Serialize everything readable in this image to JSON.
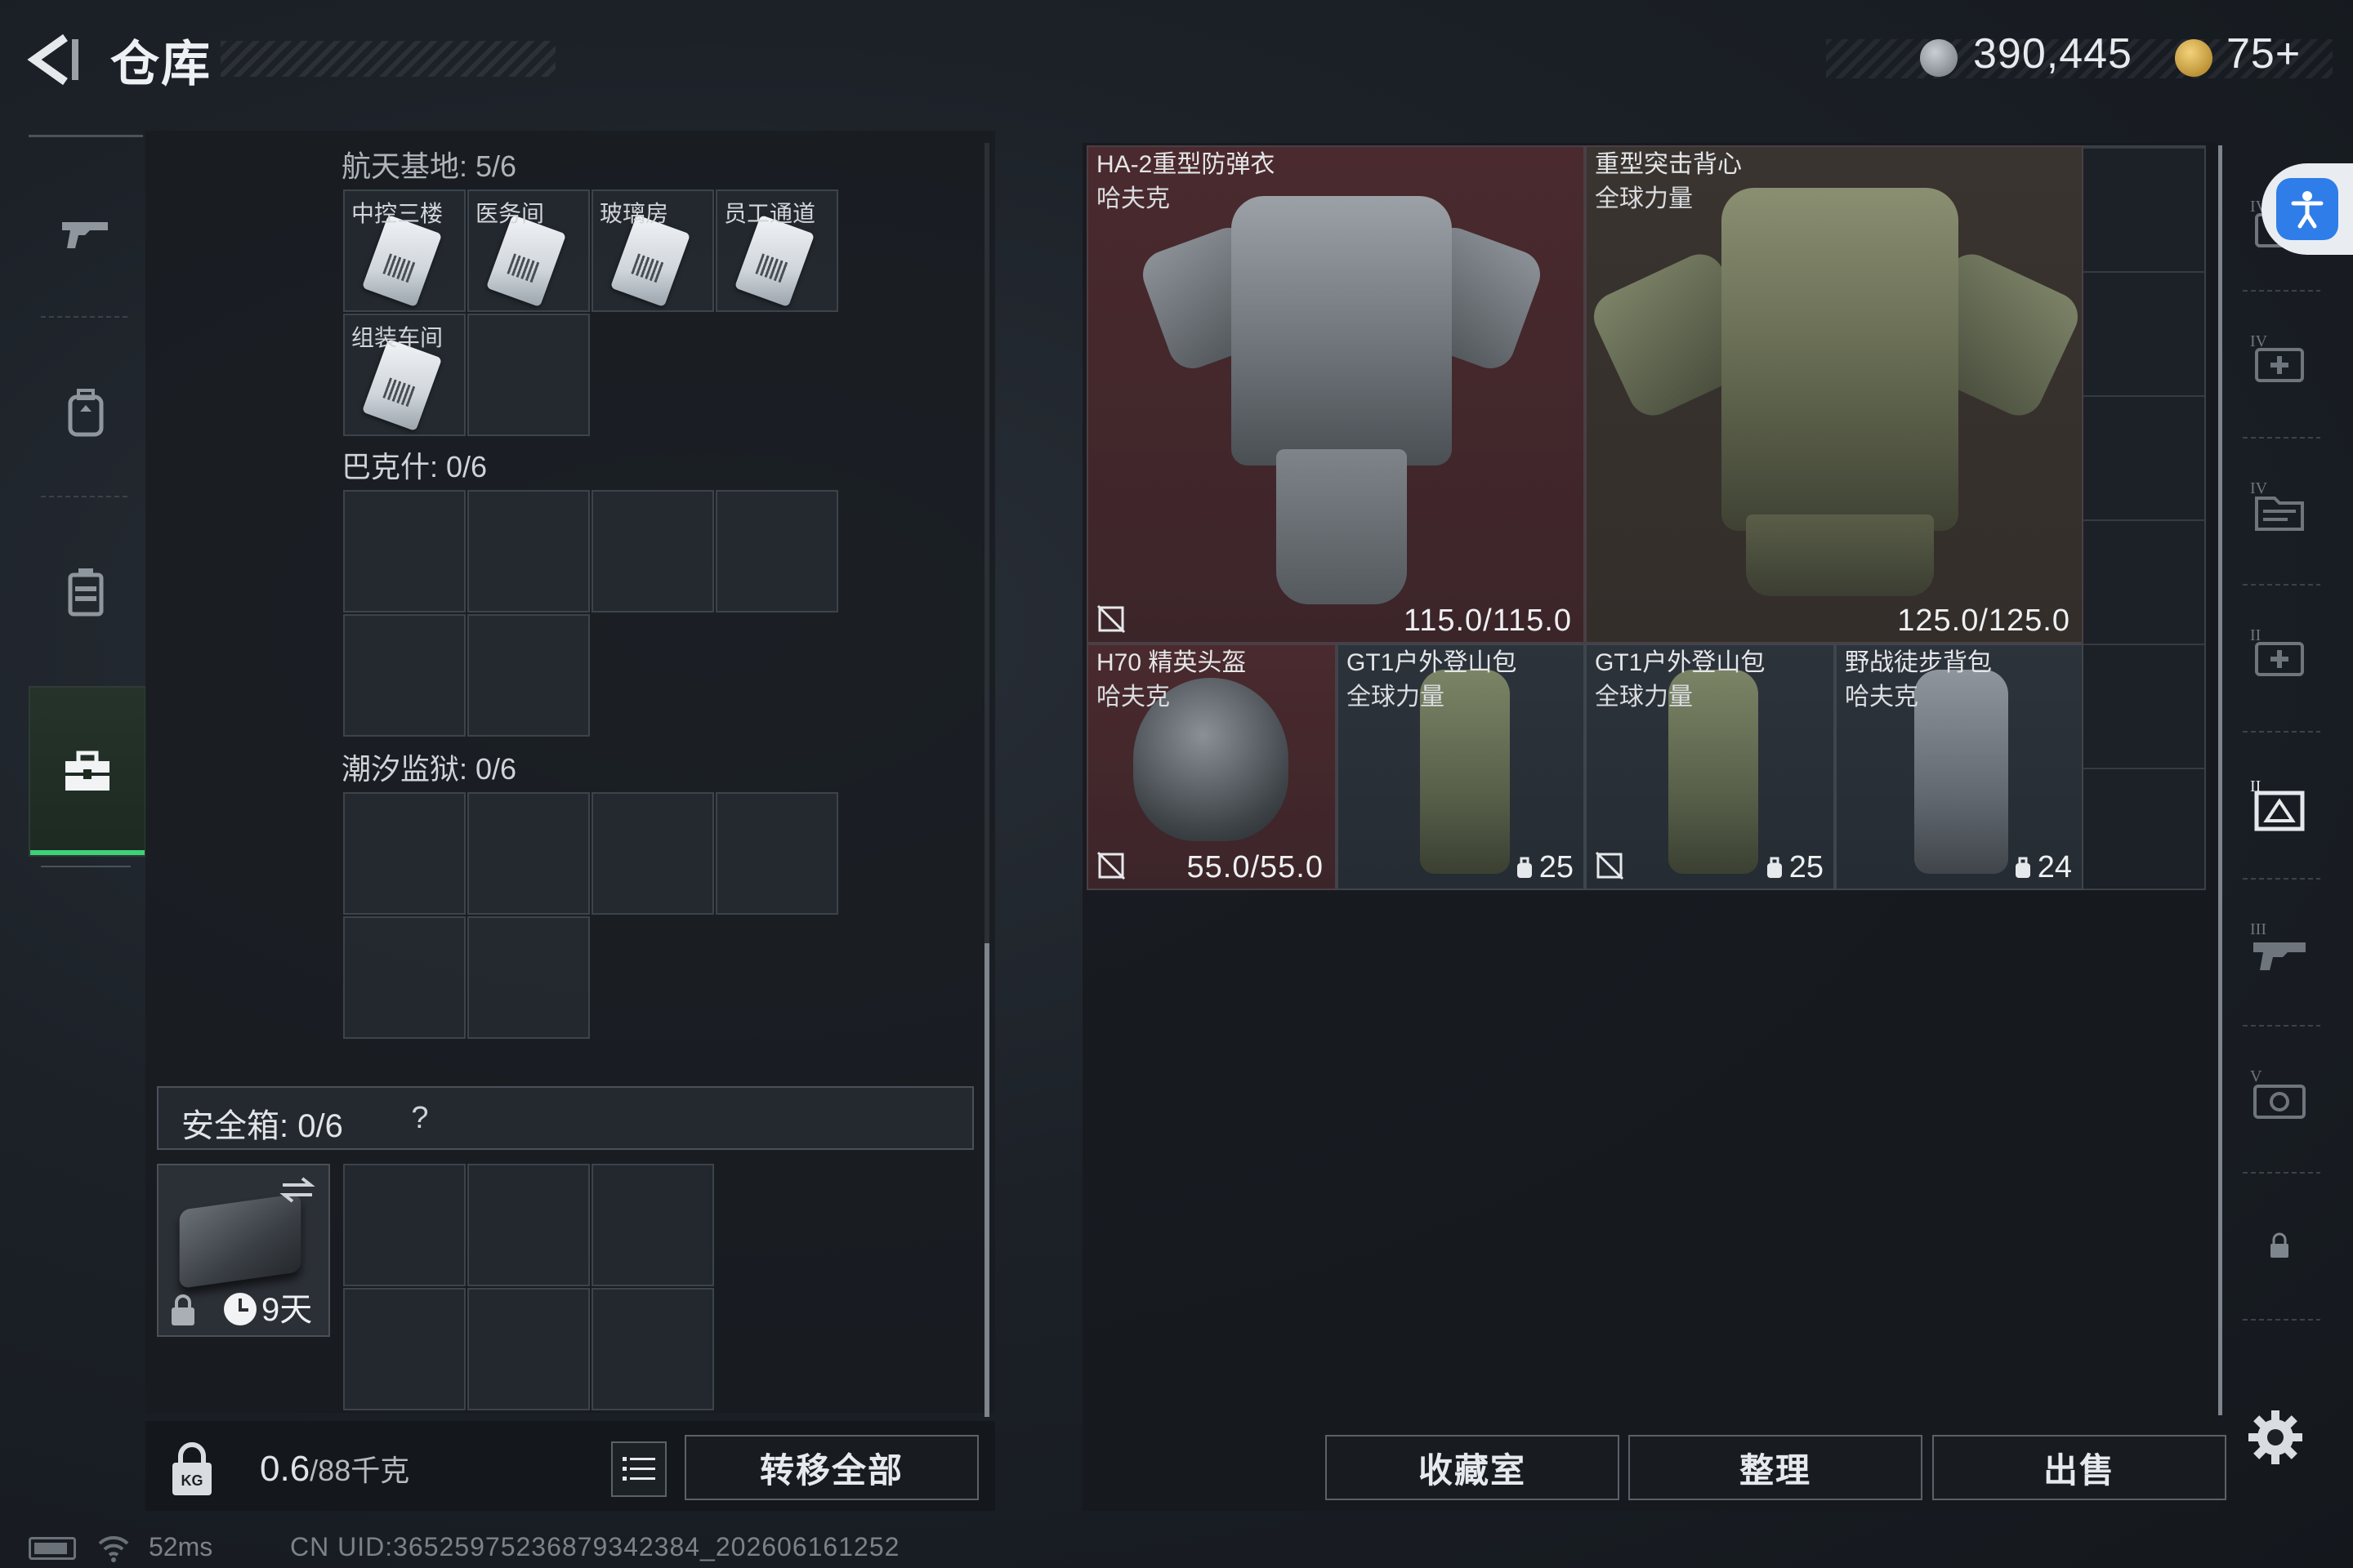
{
  "header": {
    "title": "仓库",
    "currencies": [
      {
        "icon": "silver-coin-icon",
        "value": "390,445"
      },
      {
        "icon": "gold-coin-icon",
        "value": "75+"
      }
    ]
  },
  "left_nav": {
    "items": [
      {
        "name": "weapons",
        "icon": "gun-icon"
      },
      {
        "name": "backpack",
        "icon": "backpack-icon"
      },
      {
        "name": "chest-rig",
        "icon": "vest-icon"
      },
      {
        "name": "storage",
        "icon": "toolbox-icon",
        "active": true
      }
    ]
  },
  "storage": {
    "sections": [
      {
        "label": "航天基地: 5/6",
        "cells": [
          "中控三楼",
          "医务间",
          "玻璃房",
          "员工通道",
          "组装车间",
          ""
        ]
      },
      {
        "label": "巴克什: 0/6",
        "cells": [
          "",
          "",
          "",
          "",
          "",
          ""
        ]
      },
      {
        "label": "潮汐监狱: 0/6",
        "cells": [
          "",
          "",
          "",
          "",
          "",
          ""
        ]
      }
    ],
    "safe": {
      "title": "安全箱:  0/6",
      "help": "?",
      "days": "9天"
    }
  },
  "weight": {
    "current": "0.6",
    "max_unit": "/88千克"
  },
  "buttons": {
    "transfer_all": "转移全部",
    "collection": "收藏室",
    "sort": "整理",
    "sell": "出售"
  },
  "inventory": {
    "items": [
      {
        "name": "HA-2重型防弹衣",
        "brand": "哈夫克",
        "durability": "115.0/115.0",
        "rarity": "red",
        "no_sell": true
      },
      {
        "name": "重型突击背心",
        "brand": "全球力量",
        "durability": "125.0/125.0",
        "rarity": "olive"
      },
      {
        "name": "H70 精英头盔",
        "brand": "哈夫克",
        "durability": "55.0/55.0",
        "rarity": "red",
        "no_sell": true
      },
      {
        "name": "GT1户外登山包",
        "brand": "全球力量",
        "capacity": "25",
        "rarity": "dark"
      },
      {
        "name": "GT1户外登山包",
        "brand": "全球力量",
        "capacity": "25",
        "rarity": "dark",
        "no_sell": true
      },
      {
        "name": "野战徒步背包",
        "brand": "哈夫克",
        "capacity": "24",
        "rarity": "dark"
      }
    ]
  },
  "right_sidebar": {
    "items": [
      "tier-iv-med-icon",
      "tier-iv-folder-icon",
      "tier-ii-med-icon",
      "tier-ii-ammo-box-icon",
      "tier-iii-gun-icon",
      "tier-v-device-icon",
      "lock-icon"
    ]
  },
  "status": {
    "ping": "52ms",
    "uid": "CN UID:3652597523687934238​4_202606161252"
  }
}
